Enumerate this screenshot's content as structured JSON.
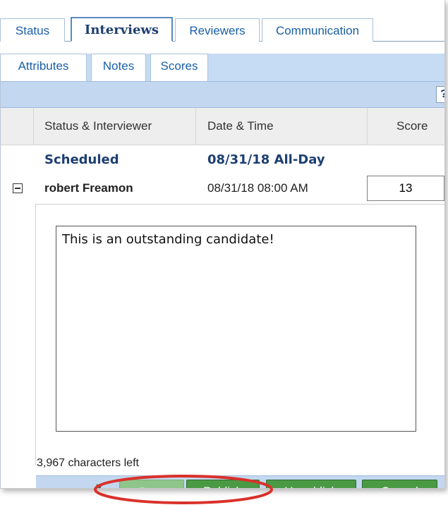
{
  "tabs_row1": [
    {
      "label": "Status",
      "active": false
    },
    {
      "label": "Interviews",
      "active": true
    },
    {
      "label": "Reviewers",
      "active": false
    },
    {
      "label": "Communication",
      "active": false
    }
  ],
  "tabs_row2": [
    {
      "label": "Attributes"
    },
    {
      "label": "Notes"
    },
    {
      "label": "Scores"
    }
  ],
  "help_label": "?",
  "grid": {
    "columns": [
      "Status & Interviewer",
      "Date & Time",
      "Score"
    ],
    "group_row": {
      "status": "Scheduled",
      "date": "08/31/18 All-Day"
    },
    "interview_row": {
      "interviewer": "robert Freamon",
      "datetime": "08/31/18 08:00 AM",
      "score": "13"
    }
  },
  "notes": {
    "text": "This is an outstanding candidate!",
    "chars_left": "3,967 characters left"
  },
  "buttons": {
    "save": "Save",
    "publish": "Publish",
    "unpublish": "Unpublish",
    "cancel": "Cancel"
  },
  "colors": {
    "button_green": "#4a9a44",
    "tab_text": "#1a5fa8",
    "highlight_red": "#d9312b",
    "toolbar_blue": "#c3d8f0"
  }
}
